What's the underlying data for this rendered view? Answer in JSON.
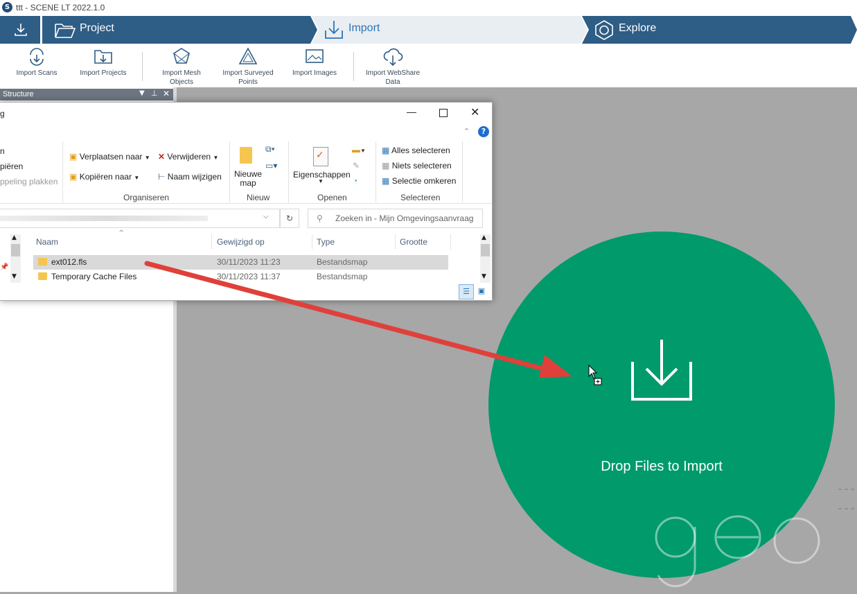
{
  "window": {
    "app_title": "ttt - SCENE LT 2022.1.0",
    "logo_letter": "S"
  },
  "nav": {
    "project_label": "Project",
    "import_label": "Import",
    "explore_label": "Explore"
  },
  "ribbon": {
    "import_scans": "Import Scans",
    "import_projects": "Import Projects",
    "import_mesh_1": "Import Mesh",
    "import_mesh_2": "Objects",
    "import_surveyed_1": "Import Surveyed",
    "import_surveyed_2": "Points",
    "import_images": "Import Images",
    "import_webshare_1": "Import WebShare",
    "import_webshare_2": "Data"
  },
  "structure_panel": {
    "title": "Structure"
  },
  "explorer": {
    "title_fragment": "g",
    "clipboard_fragments": [
      "n",
      "piëren",
      "ppeling plakken"
    ],
    "organize": {
      "move_to": "Verplaatsen naar",
      "delete": "Verwijderen",
      "copy_to": "Kopiëren naar",
      "rename": "Naam wijzigen",
      "group": "Organiseren"
    },
    "new": {
      "new_folder_1": "Nieuwe",
      "new_folder_2": "map",
      "group": "Nieuw"
    },
    "open": {
      "properties": "Eigenschappen",
      "group": "Openen"
    },
    "select": {
      "select_all": "Alles selecteren",
      "select_none": "Niets selecteren",
      "invert": "Selectie omkeren",
      "group": "Selecteren"
    },
    "search_placeholder": "Zoeken in - Mijn Omgevingsaanvraag",
    "columns": {
      "name": "Naam",
      "modified": "Gewijzigd op",
      "type": "Type",
      "size": "Grootte"
    },
    "rows": [
      {
        "name": "ext012.fls",
        "modified": "30/11/2023 11:23",
        "type": "Bestandsmap",
        "selected": true
      },
      {
        "name": "Temporary Cache Files",
        "modified": "30/11/2023 11:37",
        "type": "Bestandsmap",
        "selected": false
      }
    ]
  },
  "dropzone": {
    "label": "Drop Files to Import",
    "color": "#009a6b"
  },
  "colors": {
    "nav_dark": "#2e5d86",
    "nav_active_bg": "#e9eef3",
    "arrow": "#e0403a"
  }
}
